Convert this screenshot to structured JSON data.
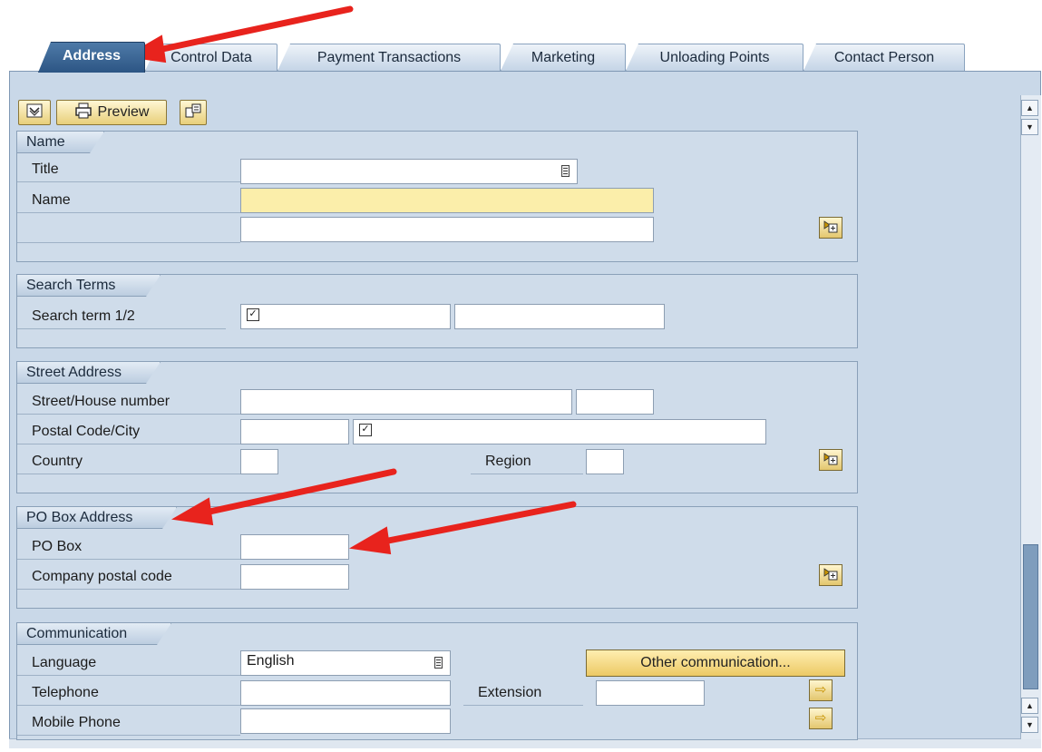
{
  "tabs": [
    "Address",
    "Control Data",
    "Payment Transactions",
    "Marketing",
    "Unloading Points",
    "Contact Person"
  ],
  "toolbar": {
    "collapse_icon": "collapse-icon",
    "preview_label": "Preview",
    "preview_icon": "printer-icon",
    "layout_icon": "layout-icon"
  },
  "groups": {
    "name": {
      "title": "Name",
      "title_label": "Title",
      "title_value": "",
      "name_label": "Name",
      "name_value": "",
      "name2_value": ""
    },
    "search": {
      "title": "Search Terms",
      "term_label": "Search term 1/2",
      "term1_value": "",
      "term2_value": ""
    },
    "street": {
      "title": "Street Address",
      "street_label": "Street/House number",
      "postal_label": "Postal Code/City",
      "country_label": "Country",
      "region_label": "Region"
    },
    "pobox": {
      "title": "PO Box Address",
      "pobox_label": "PO Box",
      "company_label": "Company postal code"
    },
    "comm": {
      "title": "Communication",
      "language_label": "Language",
      "language_value": "English",
      "telephone_label": "Telephone",
      "extension_label": "Extension",
      "mobile_label": "Mobile Phone",
      "other_button": "Other communication..."
    }
  },
  "colors": {
    "annotation_arrow": "#e8231d",
    "required_field": "#fbeeaa",
    "active_tab": "#2c5584"
  }
}
